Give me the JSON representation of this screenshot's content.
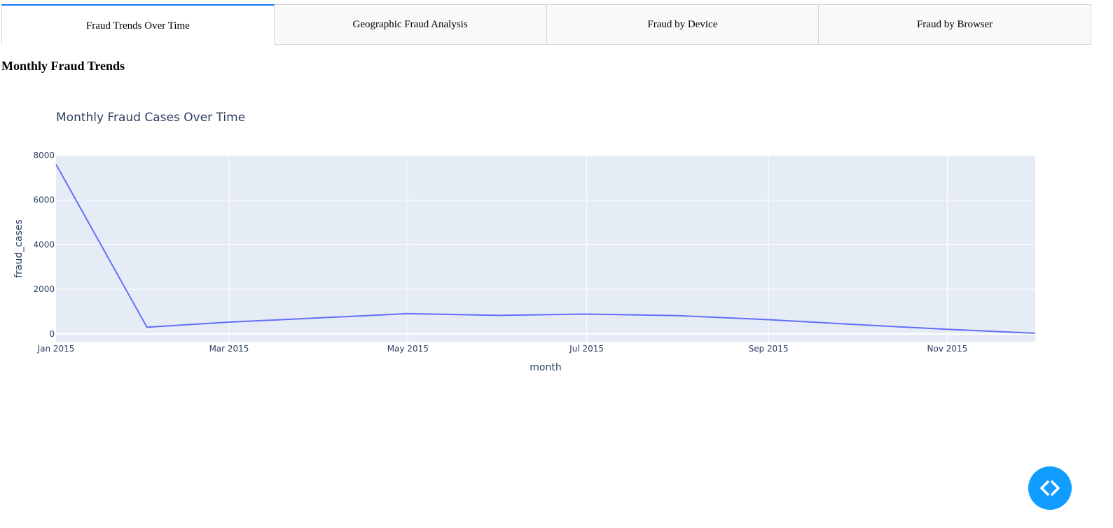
{
  "tabs": [
    {
      "label": "Fraud Trends Over Time",
      "active": true
    },
    {
      "label": "Geographic Fraud Analysis",
      "active": false
    },
    {
      "label": "Fraud by Device",
      "active": false
    },
    {
      "label": "Fraud by Browser",
      "active": false
    }
  ],
  "section_title": "Monthly Fraud Trends",
  "colors": {
    "active_tab_accent": "#1975fa",
    "plot_background": "#e5ecf6",
    "line": "#636efa",
    "fab": "#119dff"
  },
  "chart_data": {
    "type": "line",
    "title": "Monthly Fraud Cases Over Time",
    "xlabel": "month",
    "ylabel": "fraud_cases",
    "x": [
      "2015-01",
      "2015-02",
      "2015-03",
      "2015-04",
      "2015-05",
      "2015-06",
      "2015-07",
      "2015-08",
      "2015-09",
      "2015-10",
      "2015-11",
      "2015-12"
    ],
    "values": [
      7600,
      300,
      530,
      720,
      910,
      830,
      890,
      820,
      640,
      420,
      210,
      30
    ],
    "ylim": [
      -350,
      8000
    ],
    "yticks": [
      0,
      2000,
      4000,
      6000,
      8000
    ],
    "ytick_labels": [
      "0",
      "2000",
      "4000",
      "6000",
      "8000"
    ],
    "xticks": [
      "2015-01",
      "2015-03",
      "2015-05",
      "2015-07",
      "2015-09",
      "2015-11"
    ],
    "xtick_labels": [
      "Jan 2015",
      "Mar 2015",
      "May 2015",
      "Jul 2015",
      "Sep 2015",
      "Nov 2015"
    ],
    "grid": true,
    "legend": false
  },
  "fab_icon": "code-icon"
}
